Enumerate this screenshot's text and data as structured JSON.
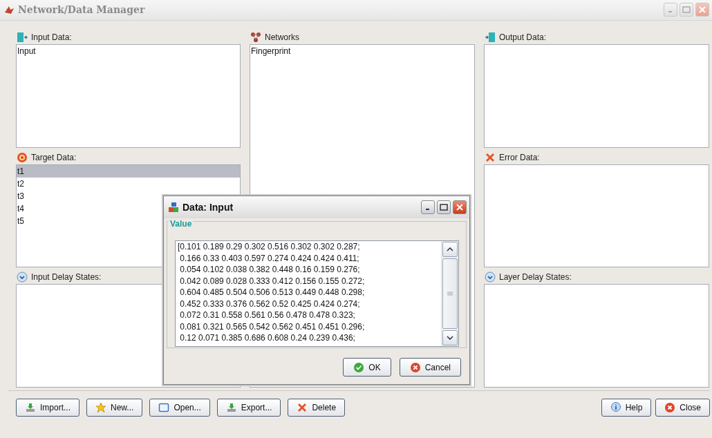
{
  "window": {
    "title": "Network/Data Manager"
  },
  "columns": [
    {
      "sections": [
        {
          "kind": "input",
          "label": "Input Data:",
          "items": [
            {
              "label": "Input",
              "selected": false
            }
          ]
        },
        {
          "kind": "target",
          "label": "Target Data:",
          "items": [
            {
              "label": "t1",
              "selected": true
            },
            {
              "label": "t2",
              "selected": false
            },
            {
              "label": "t3",
              "selected": false
            },
            {
              "label": "t4",
              "selected": false
            },
            {
              "label": "t5",
              "selected": false
            }
          ]
        },
        {
          "kind": "delay",
          "label": "Input Delay States:"
        }
      ]
    },
    {
      "sections": [
        {
          "kind": "network",
          "label": "Networks",
          "items": [
            {
              "label": "Fingerprint",
              "selected": false
            }
          ]
        }
      ]
    },
    {
      "sections": [
        {
          "kind": "output",
          "label": "Output Data:"
        },
        {
          "kind": "error",
          "label": "Error Data:"
        },
        {
          "kind": "delay",
          "label": "Layer Delay States:"
        }
      ]
    }
  ],
  "left_buttons": [
    {
      "kind": "import",
      "label": "Import..."
    },
    {
      "kind": "new",
      "label": "New..."
    },
    {
      "kind": "open",
      "label": "Open..."
    },
    {
      "kind": "export",
      "label": "Export..."
    },
    {
      "kind": "delete",
      "label": "Delete"
    }
  ],
  "right_buttons": [
    {
      "kind": "help",
      "label": "Help"
    },
    {
      "kind": "close",
      "label": "Close"
    }
  ],
  "dialog": {
    "title": "Data: Input",
    "group_label": "Value",
    "value": "[0.101 0.189 0.29 0.302 0.516 0.302 0.302 0.287;\n 0.166 0.33 0.403 0.597 0.274 0.424 0.424 0.411;\n 0.054 0.102 0.038 0.382 0.448 0.16 0.159 0.276;\n 0.042 0.089 0.028 0.333 0.412 0.156 0.155 0.272;\n 0.604 0.485 0.504 0.506 0.513 0.449 0.448 0.298;\n 0.452 0.333 0.376 0.562 0.52 0.425 0.424 0.274;\n 0.072 0.31 0.558 0.561 0.56 0.478 0.478 0.323;\n 0.081 0.321 0.565 0.542 0.562 0.451 0.451 0.296;\n 0.12 0.071 0.385 0.686 0.608 0.24 0.239 0.436;",
    "buttons": [
      {
        "kind": "ok",
        "label": "OK"
      },
      {
        "kind": "cancel",
        "label": "Cancel"
      }
    ]
  }
}
